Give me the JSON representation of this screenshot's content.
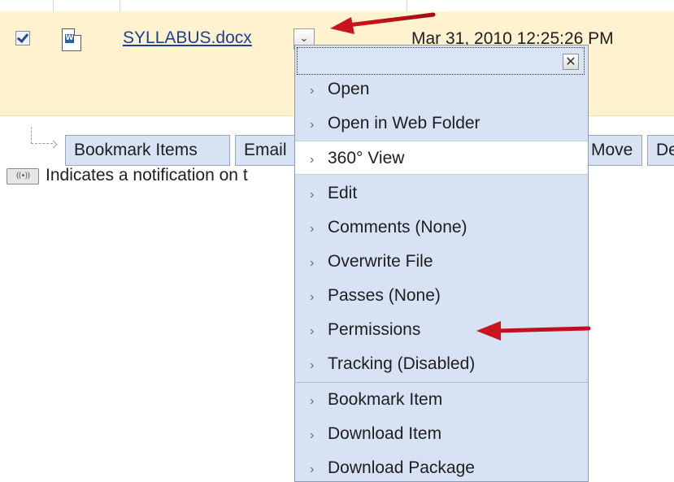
{
  "file_row": {
    "file_name": "SYLLABUS.docx",
    "timestamp": "Mar 31, 2010 12:25:26 PM",
    "checkbox_checked": true,
    "file_icon": "word-doc-icon",
    "toggle_glyph": "⌄"
  },
  "action_bar": {
    "buttons": [
      "Bookmark Items",
      "Email",
      "Move",
      "De"
    ]
  },
  "notification": {
    "icon_glyph": "((•))",
    "text": "Indicates a notification on t"
  },
  "context_menu": {
    "close_glyph": "✕",
    "chevron": "›",
    "items": [
      "Open",
      "Open in Web Folder",
      "360° View",
      "Edit",
      "Comments (None)",
      "Overwrite File",
      "Passes (None)",
      "Permissions",
      "Tracking (Disabled)",
      "Bookmark Item",
      "Download Item",
      "Download Package"
    ],
    "highlighted_index": 2
  },
  "colors": {
    "row_bg": "#fff2cf",
    "menu_bg": "#d7e2f4",
    "link": "#1b3f9a",
    "annotation_arrow": "#c8141e"
  }
}
